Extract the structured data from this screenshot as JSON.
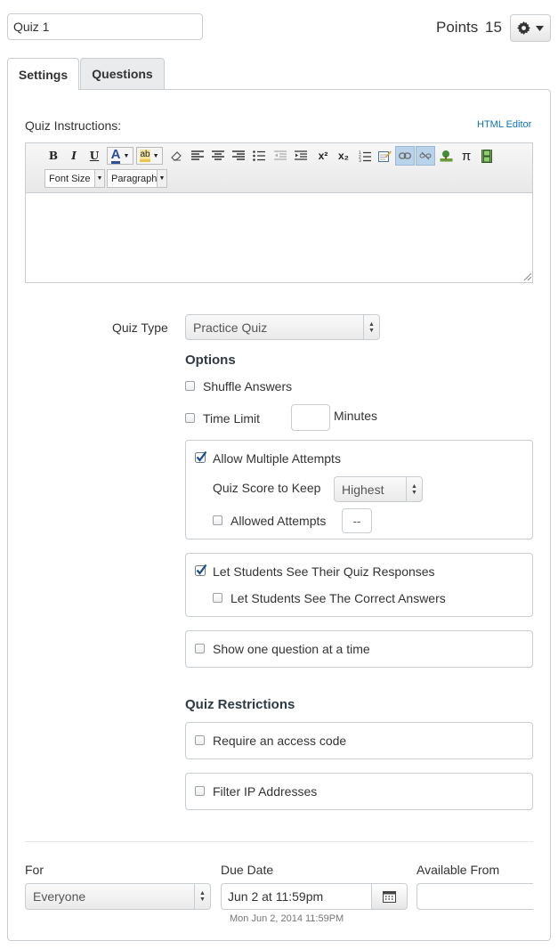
{
  "header": {
    "quiz_title": "Quiz 1",
    "points_label": "Points",
    "points_value": "15"
  },
  "tabs": [
    {
      "label": "Settings",
      "active": true
    },
    {
      "label": "Questions",
      "active": false
    }
  ],
  "instructions": {
    "label": "Quiz Instructions:",
    "html_editor_link": "HTML Editor",
    "toolbar": {
      "bold": "B",
      "italic": "I",
      "underline": "U",
      "font_color": "A",
      "superscript": "x²",
      "subscript": "x₂",
      "pi": "π",
      "font_size": "Font Size",
      "paragraph": "Paragraph"
    },
    "content": ""
  },
  "quiz_type": {
    "label": "Quiz Type",
    "value": "Practice Quiz"
  },
  "options": {
    "heading": "Options",
    "shuffle_answers": {
      "label": "Shuffle Answers",
      "checked": false
    },
    "time_limit": {
      "label": "Time Limit",
      "checked": false,
      "value": "",
      "unit": "Minutes"
    },
    "multiple_attempts": {
      "label": "Allow Multiple Attempts",
      "checked": true,
      "score_to_keep_label": "Quiz Score to Keep",
      "score_to_keep_value": "Highest",
      "allowed_attempts_label": "Allowed Attempts",
      "allowed_attempts_checked": false,
      "allowed_attempts_value": "--"
    },
    "see_responses": {
      "label": "Let Students See Their Quiz Responses",
      "checked": true,
      "correct_answers_label": "Let Students See The Correct Answers",
      "correct_answers_checked": false
    },
    "one_question": {
      "label": "Show one question at a time",
      "checked": false
    }
  },
  "restrictions": {
    "heading": "Quiz Restrictions",
    "access_code": {
      "label": "Require an access code",
      "checked": false
    },
    "filter_ip": {
      "label": "Filter IP Addresses",
      "checked": false
    }
  },
  "assign": {
    "for_label": "For",
    "for_value": "Everyone",
    "due_label": "Due Date",
    "due_value": "Jun 2 at 11:59pm",
    "due_hint": "Mon Jun 2, 2014 11:59PM",
    "available_label": "Available From",
    "available_value": ""
  },
  "colors": {
    "link": "#0b74b8",
    "border": "#c7cdd1",
    "checkbox_check": "#1a4d8f"
  }
}
